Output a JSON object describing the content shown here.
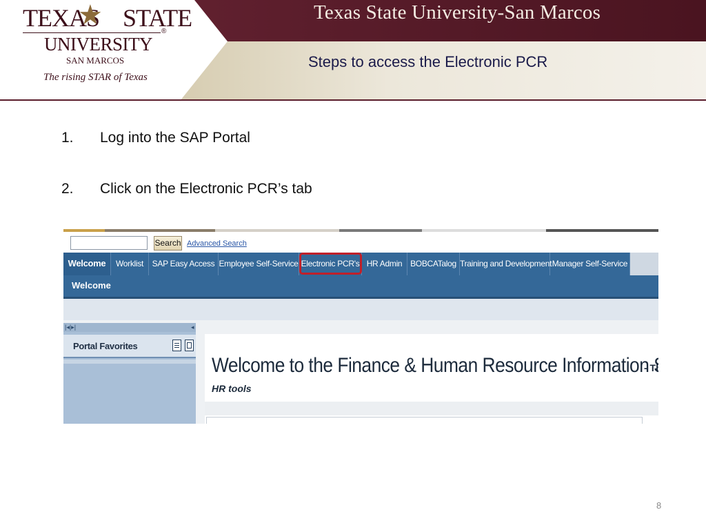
{
  "header": {
    "banner_title": "Texas State University-San Marcos",
    "slide_title": "Steps to access the Electronic PCR",
    "logo": {
      "line1_left": "TEXAS",
      "line1_right": "STATE",
      "registered": "®",
      "line2": "UNIVERSITY",
      "line3": "SAN MARCOS",
      "tagline": "The rising STAR of Texas"
    },
    "colors": {
      "maroon": "#5a1d2b",
      "gold": "#b2a27e"
    }
  },
  "steps": [
    {
      "number": "1.",
      "text": "Log into the SAP Portal"
    },
    {
      "number": "2.",
      "text": "Click on the Electronic PCR’s tab"
    }
  ],
  "portal": {
    "search": {
      "button_label": "Search",
      "advanced_link": "Advanced Search",
      "value": ""
    },
    "tabs": [
      "Welcome",
      "Worklist",
      "SAP Easy Access",
      "Employee Self-Service",
      "Electronic PCR's",
      "HR Admin",
      "BOBCATalog",
      "Training and Development",
      "Manager Self-Service"
    ],
    "active_tab": "Welcome",
    "highlighted_tab": "Electronic PCR's",
    "subnav_label": "Welcome",
    "favorites_label": "Portal Favorites",
    "welcome_heading": "Welcome to the Finance & Human Resource Information System",
    "welcome_tail": "- Th",
    "hr_tools": "HR tools",
    "colors": {
      "tab_bar": "#346898",
      "highlight_border": "#c0202a"
    }
  },
  "page_number": "8"
}
